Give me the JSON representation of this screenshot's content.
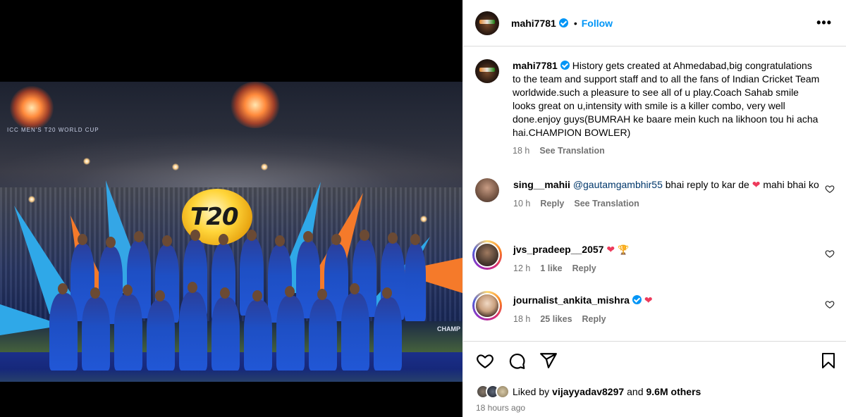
{
  "media": {
    "banner_left": "ICC MEN'S T20 WORLD CUP",
    "banner_right": "CHAMP",
    "logo_text": "T20"
  },
  "post": {
    "username": "mahi7781",
    "follow_label": "Follow",
    "dot": "•",
    "more": "•••"
  },
  "caption": {
    "username": "mahi7781",
    "text": "History gets created at Ahmedabad,big congratulations to the team and support staff and to all the fans of Indian Cricket Team worldwide.such a pleasure to see all of u play.Coach Sahab smile looks great on u,intensity with smile is a killer combo, very well done.enjoy guys(BUMRAH ke baare mein kuch na likhoon tou hi acha hai.CHAMPION BOWLER)",
    "time": "18 h",
    "see_translation": "See Translation"
  },
  "comments": [
    {
      "username": "sing__mahii",
      "mention": "@gautamgambhir55",
      "text_before": " bhai reply to kar de ",
      "text_after": " mahi bhai ko",
      "time": "10 h",
      "reply": "Reply",
      "see_translation": "See Translation"
    },
    {
      "username": "jvs_pradeep__2057",
      "time": "12 h",
      "likes": "1 like",
      "reply": "Reply"
    },
    {
      "username": "journalist_ankita_mishra",
      "time": "18 h",
      "likes": "25 likes",
      "reply": "Reply"
    }
  ],
  "likes": {
    "prefix": "Liked by ",
    "user": "vijayyadav8297",
    "middle": " and ",
    "count": "9.6M others"
  },
  "timestamp": "18 hours ago",
  "icons": {
    "like": "heart-icon",
    "comment": "comment-icon",
    "share": "share-icon",
    "save": "bookmark-icon",
    "more": "more-icon",
    "verified": "verified-badge-icon"
  },
  "colors": {
    "accent": "#0095f6",
    "heart": "#ed3a5b",
    "muted": "#737373"
  }
}
